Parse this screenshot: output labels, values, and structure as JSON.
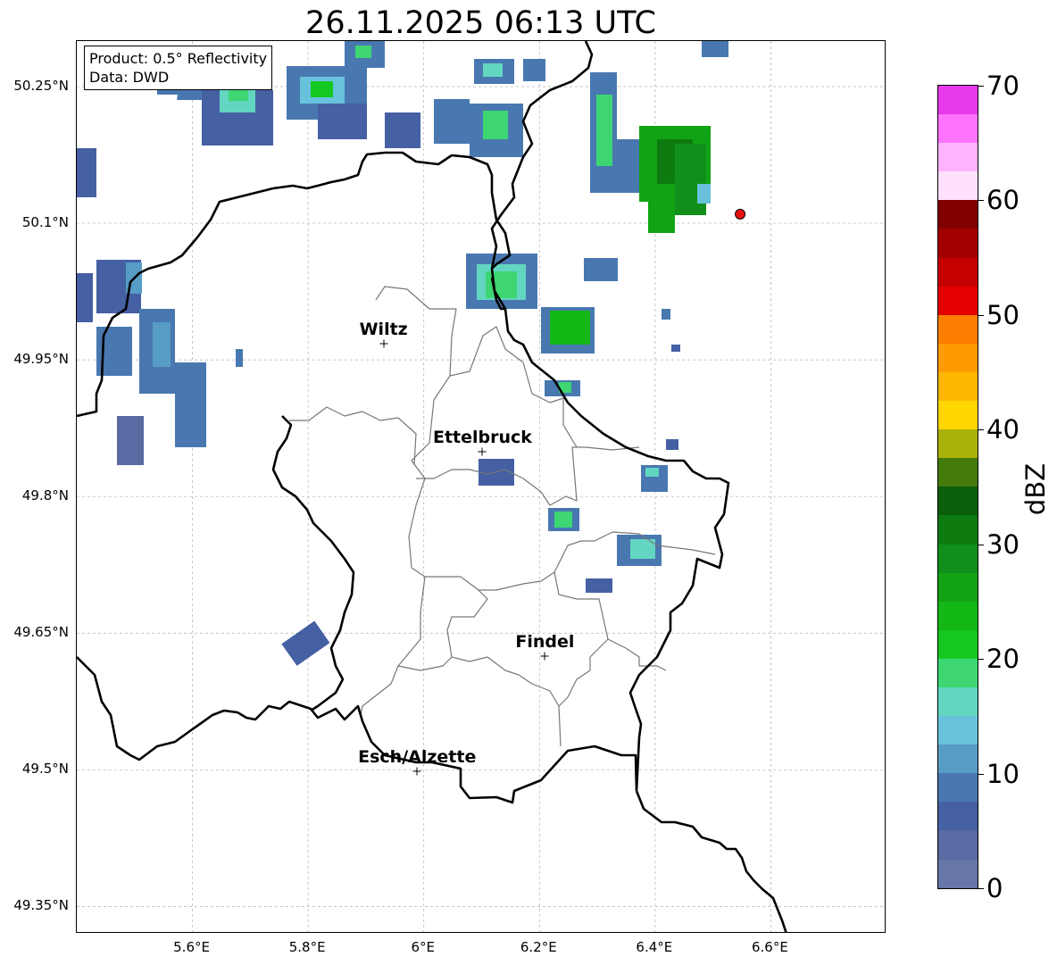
{
  "title": "26.11.2025 06:13 UTC",
  "info": {
    "product": "Product: 0.5° Reflectivity",
    "source": "Data: DWD"
  },
  "axes": {
    "lon_range": [
      5.4,
      6.8
    ],
    "lat_range": [
      49.32,
      50.3
    ],
    "lon_ticks": [
      {
        "value": 5.6,
        "label": "5.6°E"
      },
      {
        "value": 5.8,
        "label": "5.8°E"
      },
      {
        "value": 6.0,
        "label": "6°E"
      },
      {
        "value": 6.2,
        "label": "6.2°E"
      },
      {
        "value": 6.4,
        "label": "6.4°E"
      },
      {
        "value": 6.6,
        "label": "6.6°E"
      }
    ],
    "lat_ticks": [
      {
        "value": 50.25,
        "label": "50.25°N"
      },
      {
        "value": 50.1,
        "label": "50.1°N"
      },
      {
        "value": 49.95,
        "label": "49.95°N"
      },
      {
        "value": 49.8,
        "label": "49.8°N"
      },
      {
        "value": 49.65,
        "label": "49.65°N"
      },
      {
        "value": 49.5,
        "label": "49.5°N"
      },
      {
        "value": 49.35,
        "label": "49.35°N"
      }
    ],
    "grid": true
  },
  "cities": [
    {
      "name": "Wiltz",
      "lon": 5.932,
      "lat": 49.967
    },
    {
      "name": "Ettelbruck",
      "lon": 6.103,
      "lat": 49.848
    },
    {
      "name": "Findel",
      "lon": 6.211,
      "lat": 49.624
    },
    {
      "name": "Esch/Alzette",
      "lon": 5.99,
      "lat": 49.497
    }
  ],
  "radar_site": {
    "lon": 6.547,
    "lat": 50.11,
    "color": "#e8100e"
  },
  "colorbar": {
    "label": "dBZ",
    "min": 0,
    "max": 70,
    "ticks": [
      "0",
      "10",
      "20",
      "30",
      "40",
      "50",
      "60",
      "70"
    ],
    "colors": [
      "#6676a8",
      "#5a6aa2",
      "#4560a3",
      "#4978b0",
      "#579cc5",
      "#68c2dc",
      "#63d6c1",
      "#3dd673",
      "#14c820",
      "#13b716",
      "#12a314",
      "#10901a",
      "#0d7b10",
      "#0a5e0c",
      "#447a0a",
      "#aab20a",
      "#ffd600",
      "#fdb700",
      "#fd9b00",
      "#fd7d00",
      "#e50000",
      "#c60000",
      "#a30000",
      "#800000",
      "#ffe0ff",
      "#ffb3ff",
      "#ff73ff",
      "#e63aeb"
    ]
  },
  "chart_data": {
    "type": "heatmap",
    "title": "26.11.2025 06:13 UTC",
    "xlabel": "",
    "ylabel": "",
    "value_unit": "dBZ",
    "echoes": [
      {
        "lon": 5.78,
        "lat": 50.25,
        "dbz": 12
      },
      {
        "lon": 5.65,
        "lat": 50.23,
        "dbz": 10
      },
      {
        "lon": 6.15,
        "lat": 50.27,
        "dbz": 15
      },
      {
        "lon": 6.4,
        "lat": 50.17,
        "dbz": 30
      },
      {
        "lon": 6.32,
        "lat": 50.22,
        "dbz": 18
      },
      {
        "lon": 6.15,
        "lat": 50.03,
        "dbz": 18
      },
      {
        "lon": 6.26,
        "lat": 49.98,
        "dbz": 22
      },
      {
        "lon": 6.38,
        "lat": 49.72,
        "dbz": 12
      },
      {
        "lon": 6.23,
        "lat": 49.76,
        "dbz": 20
      },
      {
        "lon": 5.52,
        "lat": 49.94,
        "dbz": 8
      },
      {
        "lon": 5.81,
        "lat": 49.63,
        "dbz": 3
      }
    ]
  }
}
